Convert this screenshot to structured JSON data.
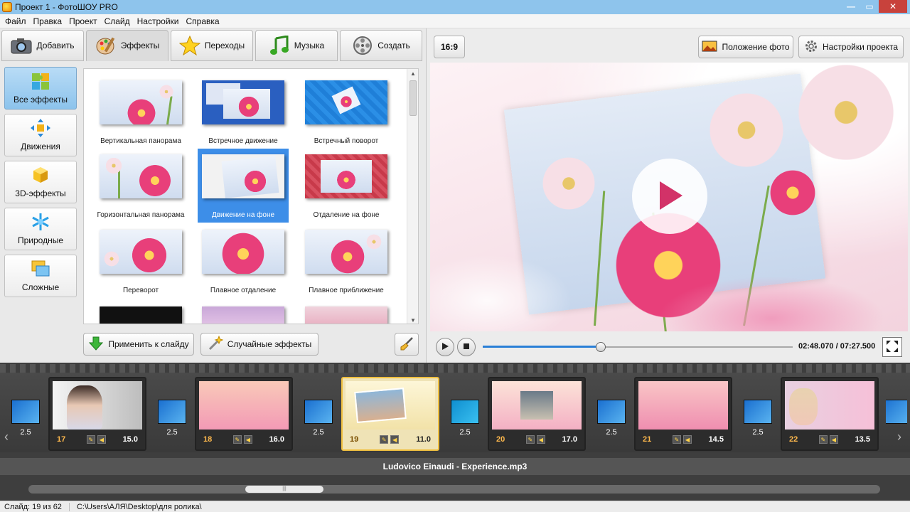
{
  "window": {
    "title": "Проект 1 - ФотоШОУ PRO",
    "controls": [
      "—",
      "▭",
      "✕"
    ]
  },
  "menu": [
    "Файл",
    "Правка",
    "Проект",
    "Слайд",
    "Настройки",
    "Справка"
  ],
  "tabs": [
    {
      "label": "Добавить",
      "icon": "camera-icon"
    },
    {
      "label": "Эффекты",
      "icon": "palette-icon"
    },
    {
      "label": "Переходы",
      "icon": "star-icon"
    },
    {
      "label": "Музыка",
      "icon": "music-note-icon"
    },
    {
      "label": "Создать",
      "icon": "film-reel-icon"
    }
  ],
  "categories": [
    {
      "label": "Все эффекты",
      "icon": "puzzle-icon"
    },
    {
      "label": "Движения",
      "icon": "move-arrows-icon"
    },
    {
      "label": "3D-эффекты",
      "icon": "cube-icon"
    },
    {
      "label": "Природные",
      "icon": "snowflake-icon"
    },
    {
      "label": "Сложные",
      "icon": "layers-icon"
    }
  ],
  "effects": [
    {
      "label": "Вертикальная панорама"
    },
    {
      "label": "Встречное движение"
    },
    {
      "label": "Встречный поворот"
    },
    {
      "label": "Горизонтальная панорама"
    },
    {
      "label": "Движение на фоне"
    },
    {
      "label": "Отдаление на фоне"
    },
    {
      "label": "Переворот"
    },
    {
      "label": "Плавное отдаление"
    },
    {
      "label": "Плавное приближение"
    }
  ],
  "buttons": {
    "apply": "Применить к слайду",
    "random": "Случайные эффекты",
    "aspect": "16:9",
    "photo_position": "Положение фото",
    "project_settings": "Настройки проекта"
  },
  "player": {
    "time": "02:48.070 / 07:27.500",
    "progress": 0.38
  },
  "slides": [
    {
      "num": "17",
      "dur": "15.0"
    },
    {
      "num": "18",
      "dur": "16.0"
    },
    {
      "num": "19",
      "dur": "11.0"
    },
    {
      "num": "20",
      "dur": "17.0"
    },
    {
      "num": "21",
      "dur": "14.5"
    },
    {
      "num": "22",
      "dur": "13.5"
    }
  ],
  "transitions": [
    "2.5",
    "2.5",
    "2.5",
    "2.5",
    "2.5",
    "2.5",
    "2.5"
  ],
  "audio": "Ludovico Einaudi - Experience.mp3",
  "status": {
    "slide": "Слайд: 19 из 62",
    "path": "C:\\Users\\АЛЯ\\Desktop\\для ролика\\"
  }
}
